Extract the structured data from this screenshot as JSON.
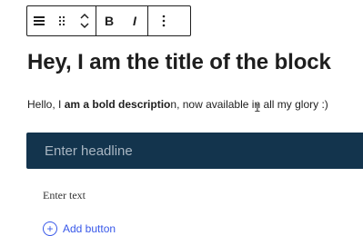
{
  "toolbar": {
    "align_icon": "align-icon",
    "drag_icon": "drag-handle-icon",
    "move_icon": "move-up-down-icon",
    "bold_label": "B",
    "italic_label": "I",
    "more_icon": "more-options-icon"
  },
  "block": {
    "title": "Hey, I am the title of the block",
    "desc_prefix": "Hello, I ",
    "desc_bold": "am a bold descriptio",
    "desc_suffix": "n, now available in all my glory :)"
  },
  "headline": {
    "placeholder": "Enter headline"
  },
  "text": {
    "placeholder": "Enter text"
  },
  "add_button": {
    "label": "Add button"
  },
  "colors": {
    "headline_bg": "#13344d",
    "accent": "#3858e9"
  }
}
